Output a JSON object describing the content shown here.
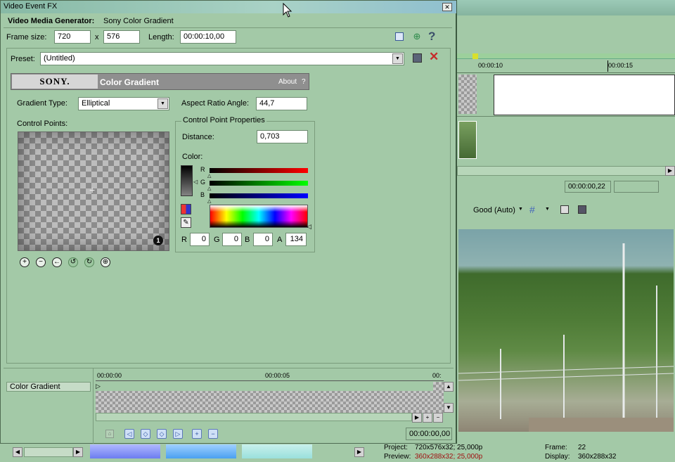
{
  "window": {
    "title": "Video Event FX",
    "close": "✕"
  },
  "header": {
    "plugin_prefix": "Video Media Generator:",
    "plugin_name": "Sony Color Gradient"
  },
  "frame": {
    "size_label": "Frame size:",
    "width": "720",
    "x_sep": "x",
    "height": "576",
    "length_label": "Length:",
    "length": "00:00:10,00"
  },
  "preset": {
    "label": "Preset:",
    "value": "(Untitled)"
  },
  "plugin": {
    "brand": "SONY.",
    "title": "Color Gradient",
    "about": "About",
    "help": "?"
  },
  "gradient": {
    "type_label": "Gradient Type:",
    "type_value": "Elliptical",
    "aspect_label": "Aspect Ratio Angle:",
    "aspect_value": "44,7"
  },
  "control_points": {
    "label": "Control Points:",
    "marker": "1"
  },
  "props": {
    "group": "Control Point Properties",
    "distance_label": "Distance:",
    "distance_value": "0,703",
    "color_label": "Color:",
    "r": "R",
    "g": "G",
    "b": "B",
    "a": "A",
    "r_value": "0",
    "g_value": "0",
    "b_value": "0",
    "a_value": "134"
  },
  "track": {
    "name": "Color Gradient",
    "t0": "00:00:00",
    "t1": "00:00:05",
    "t2": "00:",
    "cursor": "00:00:00,00"
  },
  "timeline": {
    "t1": "00:00:10",
    "t2": "00:00:15",
    "time": "00:00:00,22"
  },
  "preview": {
    "quality": "Good (Auto)"
  },
  "status": {
    "project_label": "Project:",
    "project_value": "720x576x32; 25,000p",
    "preview_label": "Preview:",
    "preview_value": "360x288x32; 25,000p",
    "frame_label": "Frame:",
    "frame_value": "22",
    "display_label": "Display:",
    "display_value": "360x288x32"
  },
  "colors": {
    "accent": "#a3c9a7",
    "title_bar": "#8fb8c5",
    "sony_header": "#8f8f8f"
  }
}
